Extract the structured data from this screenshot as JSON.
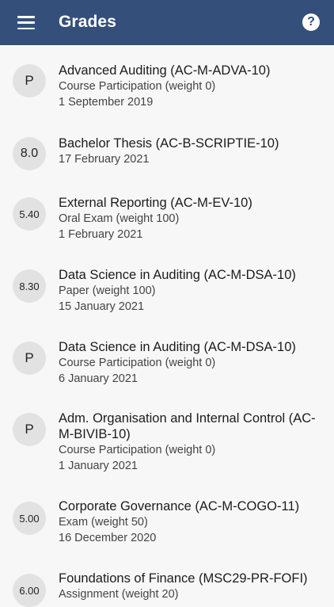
{
  "app": {
    "title": "Grades",
    "help_label": "?"
  },
  "grades": [
    {
      "grade": "P",
      "course": "Advanced Auditing (AC-M-ADVA-10)",
      "component": "Course Participation (weight 0)",
      "date": "1 September 2019"
    },
    {
      "grade": "8.0",
      "course": "Bachelor Thesis (AC-B-SCRIPTIE-10)",
      "component": "",
      "date": "17 February 2021"
    },
    {
      "grade": "5.40",
      "course": "External Reporting (AC-M-EV-10)",
      "component": "Oral Exam (weight 100)",
      "date": "1 February 2021"
    },
    {
      "grade": "8.30",
      "course": "Data Science in Auditing (AC-M-DSA-10)",
      "component": "Paper (weight 100)",
      "date": "15 January 2021"
    },
    {
      "grade": "P",
      "course": "Data Science in Auditing (AC-M-DSA-10)",
      "component": "Course Participation (weight 0)",
      "date": "6 January 2021"
    },
    {
      "grade": "P",
      "course": "Adm. Organisation and Internal Control (AC-M-BIVIB-10)",
      "component": "Course Participation (weight 0)",
      "date": "1 January 2021"
    },
    {
      "grade": "5.00",
      "course": "Corporate Governance (AC-M-COGO-11)",
      "component": "Exam (weight 50)",
      "date": "16 December 2020"
    },
    {
      "grade": "6.00",
      "course": "Foundations of Finance (MSC29-PR-FOFI)",
      "component": "Assignment (weight 20)",
      "date": ""
    }
  ]
}
